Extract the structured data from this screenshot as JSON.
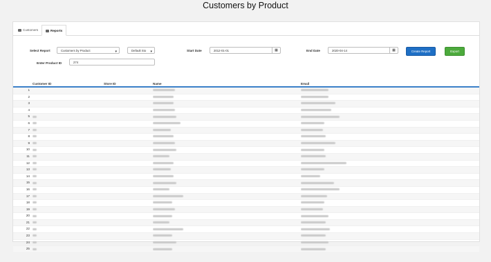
{
  "page": {
    "title": "Customers by Product"
  },
  "tabs": [
    {
      "label": "Customers",
      "icon": "users-icon",
      "active": false
    },
    {
      "label": "Reports",
      "icon": "table-icon",
      "active": true
    }
  ],
  "filters": {
    "select_report_label": "Select Report",
    "select_report_value": "Customers by Product",
    "store_value": "Default Sto",
    "start_date_label": "Start Date",
    "start_date_value": "2012-01-01",
    "end_date_label": "End Date",
    "end_date_value": "2020-04-14",
    "product_id_label": "Enter Product ID",
    "product_id_value": "274"
  },
  "buttons": {
    "create_report": "Create Report",
    "export": "Export"
  },
  "table": {
    "columns": [
      "Customer ID",
      "Store ID",
      "Name",
      "Email"
    ],
    "row_numbers": [
      1,
      2,
      3,
      4,
      5,
      6,
      7,
      8,
      9,
      10,
      11,
      12,
      13,
      14,
      15,
      16,
      17,
      18,
      19,
      20,
      21,
      22,
      23,
      24,
      25
    ]
  },
  "colors": {
    "create_button": "#1e6fc5",
    "export_button": "#4caa3c",
    "header_rule": "#3a80c8"
  }
}
